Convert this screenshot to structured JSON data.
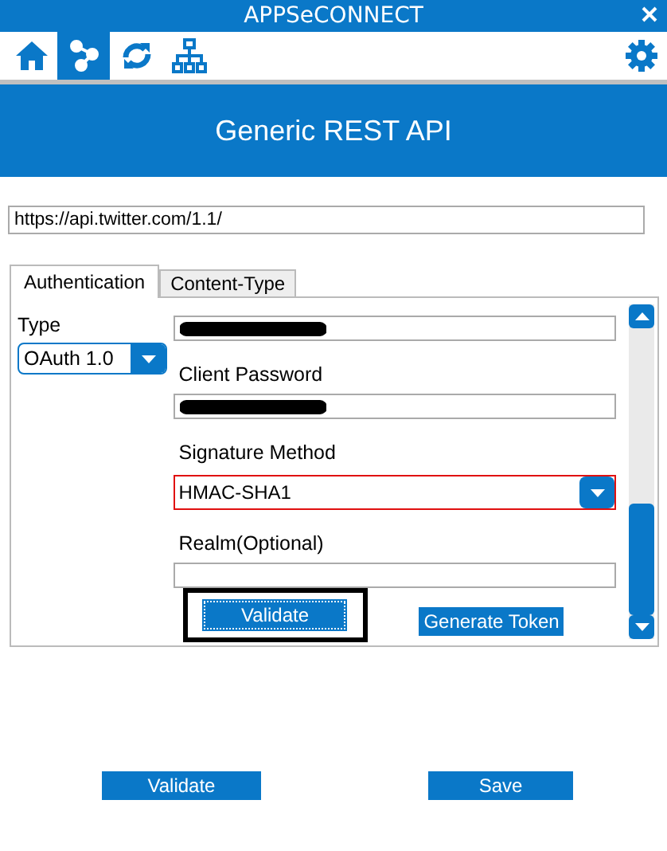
{
  "window": {
    "title": "APPSeCONNECT"
  },
  "toolbar": [
    {
      "kind": "home",
      "selected": false
    },
    {
      "kind": "connector",
      "selected": true
    },
    {
      "kind": "sync",
      "selected": false
    },
    {
      "kind": "hierarchy",
      "selected": false
    }
  ],
  "header": {
    "title": "Generic REST API"
  },
  "url_field": {
    "value": "https://api.twitter.com/1.1/"
  },
  "tabs": [
    {
      "label": "Authentication",
      "selected": true
    },
    {
      "label": "Content-Type",
      "selected": false
    }
  ],
  "type": {
    "label": "Type",
    "value": "OAuth 1.0"
  },
  "form": [
    {
      "kind": "redacted"
    },
    {
      "kind": "label",
      "text": "Client Password"
    },
    {
      "kind": "redacted"
    },
    {
      "kind": "label",
      "text": "Signature Method"
    },
    {
      "kind": "combo",
      "value": "HMAC-SHA1",
      "invalid": true
    },
    {
      "kind": "label",
      "text": "Realm(Optional)"
    },
    {
      "kind": "input"
    }
  ],
  "form_buttons": [
    {
      "label": "Validate",
      "focused": true
    },
    {
      "label": "Generate Token",
      "focused": false
    }
  ],
  "footer_buttons": [
    "Validate",
    "Save"
  ]
}
